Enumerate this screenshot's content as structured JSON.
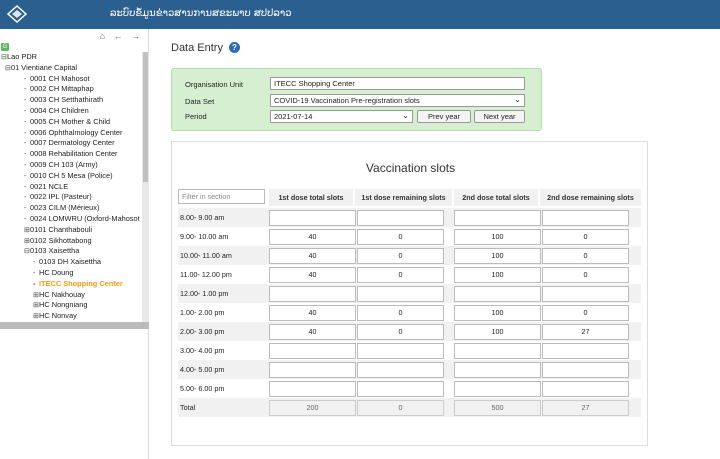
{
  "header": {
    "app_title": "ລະບົບຂໍ້ມູນຂ່າວສານການສຂະພາບ ສປປລາວ"
  },
  "tree": {
    "nav_icons": [
      "home-icon",
      "arrow-left-icon",
      "arrow-right-icon"
    ],
    "nav_glyphs": "⌂ ← →",
    "badge": "G",
    "items": [
      {
        "label": "Lao PDR",
        "toggle": "⊟",
        "level": 0
      },
      {
        "label": "01 Vientiane Capital",
        "toggle": "⊟",
        "level": 1
      },
      {
        "label": "0001 CH Mahosot",
        "toggle": "",
        "level": 2
      },
      {
        "label": "0002 CH Mittaphap",
        "toggle": "",
        "level": 2
      },
      {
        "label": "0003 CH Setthathirath",
        "toggle": "",
        "level": 2
      },
      {
        "label": "0004 CH Children",
        "toggle": "",
        "level": 2
      },
      {
        "label": "0005 CH Mother & Child",
        "toggle": "",
        "level": 2
      },
      {
        "label": "0006 Ophthalmology Center",
        "toggle": "",
        "level": 2
      },
      {
        "label": "0007 Dermatology Center",
        "toggle": "",
        "level": 2
      },
      {
        "label": "0008 Rehabilitation Center",
        "toggle": "",
        "level": 2
      },
      {
        "label": "0009 CH 103 (Army)",
        "toggle": "",
        "level": 2
      },
      {
        "label": "0010 CH 5 Mesa (Police)",
        "toggle": "",
        "level": 2
      },
      {
        "label": "0021 NCLE",
        "toggle": "",
        "level": 2
      },
      {
        "label": "0022 IPL (Pasteur)",
        "toggle": "",
        "level": 2
      },
      {
        "label": "0023 CILM (Mérieux)",
        "toggle": "",
        "level": 2
      },
      {
        "label": "0024 LOMWRU (Oxford-Mahosot",
        "toggle": "",
        "level": 2
      },
      {
        "label": "0101 Chanthabouli",
        "toggle": "⊞",
        "level": 2
      },
      {
        "label": "0102 Sikhottabong",
        "toggle": "⊞",
        "level": 2
      },
      {
        "label": "0103 Xaisettha",
        "toggle": "⊟",
        "level": 2
      },
      {
        "label": "0103 DH Xaisettha",
        "toggle": "",
        "level": 3
      },
      {
        "label": "HC Doung",
        "toggle": "",
        "level": 3
      },
      {
        "label": "ITECC Shopping Center",
        "toggle": "",
        "level": 3,
        "selected": true
      },
      {
        "label": "HC Nakhouay",
        "toggle": "⊞",
        "level": 3
      },
      {
        "label": "HC Nongniang",
        "toggle": "⊞",
        "level": 3
      },
      {
        "label": "HC Nonvay",
        "toggle": "⊞",
        "level": 3
      }
    ]
  },
  "page": {
    "title": "Data Entry",
    "help_glyph": "?"
  },
  "selection": {
    "org_label": "Organisation Unit",
    "org_value": "ITECC Shopping Center",
    "dataset_label": "Data Set",
    "dataset_value": "COVID-19 Vaccination Pre-registration slots",
    "period_label": "Period",
    "period_value": "2021-07-14",
    "prev_year": "Prev year",
    "next_year": "Next year",
    "caret": "⌄"
  },
  "section": {
    "title": "Vaccination slots",
    "filter_placeholder": "Filter in section",
    "columns": [
      "1st dose total slots",
      "1st dose remaining slots",
      "2nd dose total slots",
      "2nd dose remaining slots"
    ],
    "rows": [
      {
        "label": "8.00- 9.00 am",
        "values": [
          "",
          "",
          "",
          ""
        ]
      },
      {
        "label": "9.00- 10.00 am",
        "values": [
          "40",
          "0",
          "100",
          "0"
        ]
      },
      {
        "label": "10.00- 11.00 am",
        "values": [
          "40",
          "0",
          "100",
          "0"
        ]
      },
      {
        "label": "11.00- 12.00 pm",
        "values": [
          "40",
          "0",
          "100",
          "0"
        ]
      },
      {
        "label": "12.00- 1.00 pm",
        "values": [
          "",
          "",
          "",
          ""
        ]
      },
      {
        "label": "1.00- 2.00 pm",
        "values": [
          "40",
          "0",
          "100",
          "0"
        ]
      },
      {
        "label": "2.00- 3.00 pm",
        "values": [
          "40",
          "0",
          "100",
          "27"
        ]
      },
      {
        "label": "3.00- 4.00 pm",
        "values": [
          "",
          "",
          "",
          ""
        ]
      },
      {
        "label": "4.00- 5.00 pm",
        "values": [
          "",
          "",
          "",
          ""
        ]
      },
      {
        "label": "5.00- 6.00 pm",
        "values": [
          "",
          "",
          "",
          ""
        ]
      }
    ],
    "total": {
      "label": "Total",
      "values": [
        "200",
        "0",
        "500",
        "27"
      ]
    }
  }
}
